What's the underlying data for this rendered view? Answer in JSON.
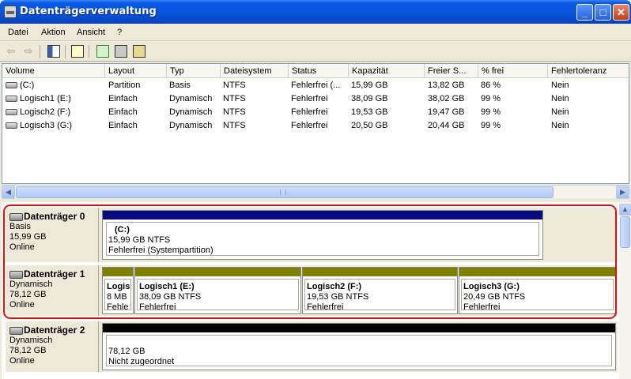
{
  "window": {
    "title": "Datenträgerverwaltung",
    "minimize_label": "_",
    "maximize_label": "□",
    "close_label": "✕"
  },
  "menu": [
    "Datei",
    "Aktion",
    "Ansicht",
    "?"
  ],
  "toolbar": {
    "back_label": "⇦",
    "forward_label": "⇨",
    "icons": [
      "back-icon",
      "forward-icon",
      "show-hide-tree-icon",
      "properties-icon",
      "help-icon",
      "refresh-icon",
      "rescan-icon",
      "settings-icon"
    ]
  },
  "volumes": {
    "columns": [
      "Volume",
      "Layout",
      "Typ",
      "Dateisystem",
      "Status",
      "Kapazität",
      "Freier S...",
      "% frei",
      "Fehlertoleranz"
    ],
    "rows": [
      [
        "(C:)",
        "Partition",
        "Basis",
        "NTFS",
        "Fehlerfrei (...",
        "15,99 GB",
        "13,82 GB",
        "86 %",
        "Nein"
      ],
      [
        "Logisch1 (E:)",
        "Einfach",
        "Dynamisch",
        "NTFS",
        "Fehlerfrei",
        "38,09 GB",
        "38,02 GB",
        "99 %",
        "Nein"
      ],
      [
        "Logisch2 (F:)",
        "Einfach",
        "Dynamisch",
        "NTFS",
        "Fehlerfrei",
        "19,53 GB",
        "19,47 GB",
        "99 %",
        "Nein"
      ],
      [
        "Logisch3 (G:)",
        "Einfach",
        "Dynamisch",
        "NTFS",
        "Fehlerfrei",
        "20,50 GB",
        "20,44 GB",
        "99 %",
        "Nein"
      ]
    ]
  },
  "scroll": {
    "left_arrow": "◀",
    "right_arrow": "▶",
    "up_arrow": "▲"
  },
  "disks": [
    {
      "name": "Datenträger 0",
      "type": "Basis",
      "size": "15,99 GB",
      "state": "Online",
      "partitions": [
        {
          "name": "(C:)",
          "info": "15,99 GB NTFS",
          "status": "Fehlerfrei (Systempartition)",
          "bar_color": "#0a0a80"
        }
      ]
    },
    {
      "name": "Datenträger 1",
      "type": "Dynamisch",
      "size": "78,12 GB",
      "state": "Online",
      "partitions": [
        {
          "name": "Logis",
          "info": "8 MB",
          "status": "Fehle",
          "bar_color": "#808000"
        },
        {
          "name": "Logisch1  (E:)",
          "info": "38,09 GB NTFS",
          "status": "Fehlerfrei",
          "bar_color": "#808000"
        },
        {
          "name": "Logisch2  (F:)",
          "info": "19,53 GB NTFS",
          "status": "Fehlerfrei",
          "bar_color": "#808000"
        },
        {
          "name": "Logisch3  (G:)",
          "info": "20,49 GB NTFS",
          "status": "Fehlerfrei",
          "bar_color": "#808000"
        }
      ]
    },
    {
      "name": "Datenträger 2",
      "type": "Dynamisch",
      "size": "78,12 GB",
      "state": "Online",
      "partitions": [
        {
          "name": "",
          "info": "78,12 GB",
          "status": "Nicht zugeordnet",
          "bar_color": "#000000"
        }
      ]
    }
  ]
}
